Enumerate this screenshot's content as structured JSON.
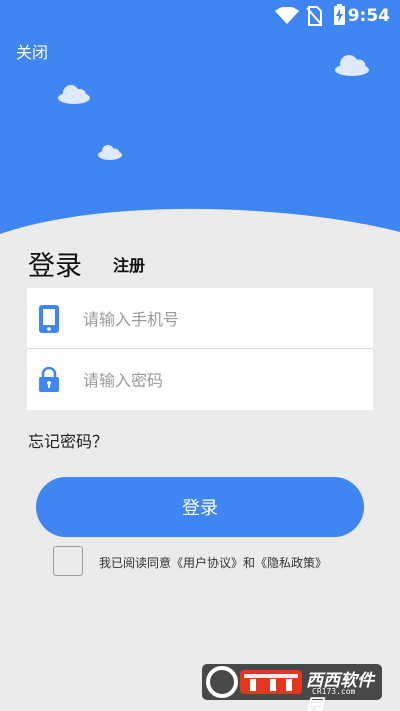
{
  "status_bar": {
    "time": "9:54",
    "icons": [
      "wifi-icon",
      "no-sim-icon",
      "battery-charging-icon"
    ]
  },
  "header": {
    "close_label": "关闭",
    "background_color": "#3f86f3"
  },
  "tabs": {
    "login": "登录",
    "register": "注册"
  },
  "form": {
    "phone_placeholder": "请输入手机号",
    "password_placeholder": "请输入密码",
    "phone_icon": "phone-icon",
    "password_icon": "lock-icon",
    "icon_color": "#3f86f3"
  },
  "forgot_password_label": "忘记密码？",
  "login_button_label": "登录",
  "agreement": {
    "checked": false,
    "text": "我已阅读同意《用户协议》和《隐私政策》"
  },
  "watermark": {
    "brand": "西西软件园",
    "url": "CR173.com"
  }
}
